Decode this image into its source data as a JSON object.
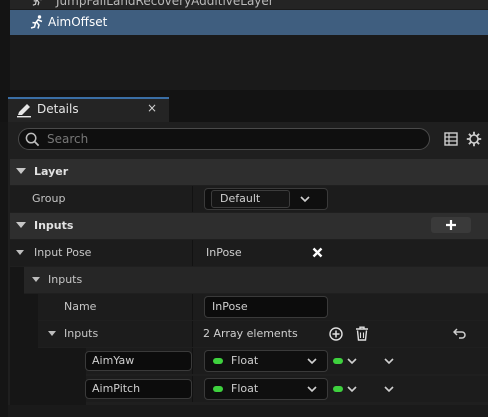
{
  "outliner": {
    "items": [
      {
        "label": "JumpFallLandRecoveryAdditiveLayer"
      },
      {
        "label": "AimOffset",
        "selected": true
      }
    ]
  },
  "details_tab": {
    "title": "Details",
    "close": "×"
  },
  "search": {
    "placeholder": "Search"
  },
  "categories": {
    "layer": {
      "title": "Layer",
      "group_label": "Group",
      "group_value": "Default"
    },
    "inputs": {
      "title": "Inputs"
    }
  },
  "input_pose": {
    "label": "Input Pose",
    "value": "InPose",
    "subcategory": "Inputs",
    "name_label": "Name",
    "name_value": "InPose",
    "inputs_label": "Inputs",
    "array_text": "2 Array elements",
    "elements": [
      {
        "name": "AimYaw",
        "type": "Float"
      },
      {
        "name": "AimPitch",
        "type": "Float"
      }
    ]
  },
  "colors": {
    "selected_row": "#3f5e7f",
    "tab_accent": "#3a6ea5",
    "pin_green": "#3ed13e"
  }
}
